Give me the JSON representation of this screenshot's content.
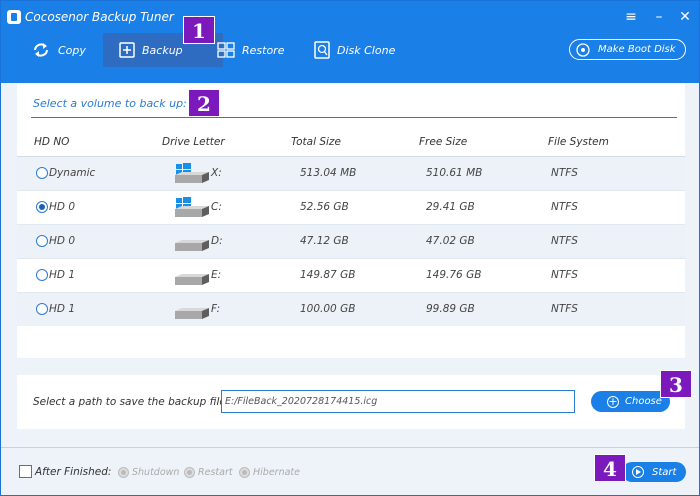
{
  "window": {
    "title": "Cocosenor Backup Tuner",
    "logo_icon": "app-logo-icon",
    "controls": [
      "menu-icon",
      "minimize-icon",
      "close-icon"
    ]
  },
  "nav": {
    "items": [
      {
        "label": "Copy",
        "icon": "copy-icon"
      },
      {
        "label": "Backup",
        "icon": "backup-icon",
        "active": true
      },
      {
        "label": "Restore",
        "icon": "restore-icon"
      },
      {
        "label": "Disk Clone",
        "icon": "disk-clone-icon"
      }
    ],
    "boot_disk_label": "Make Boot Disk"
  },
  "markers": [
    "1",
    "2",
    "3",
    "4"
  ],
  "volume": {
    "heading": "Select a volume to back up:",
    "columns": [
      "HD NO",
      "Drive Letter",
      "Total Size",
      "Free Size",
      "File System"
    ],
    "rows": [
      {
        "hd": "Dynamic",
        "letter": "X:",
        "total": "513.04 MB",
        "free": "510.61 MB",
        "fs": "NTFS",
        "selected": false,
        "icon": "windows-drive-icon"
      },
      {
        "hd": "HD 0",
        "letter": "C:",
        "total": "52.56 GB",
        "free": "29.41 GB",
        "fs": "NTFS",
        "selected": true,
        "icon": "windows-drive-icon"
      },
      {
        "hd": "HD 0",
        "letter": "D:",
        "total": "47.12 GB",
        "free": "47.02 GB",
        "fs": "NTFS",
        "selected": false,
        "icon": "drive-icon"
      },
      {
        "hd": "HD 1",
        "letter": "E:",
        "total": "149.87 GB",
        "free": "149.76 GB",
        "fs": "NTFS",
        "selected": false,
        "icon": "drive-icon"
      },
      {
        "hd": "HD 1",
        "letter": "F:",
        "total": "100.00 GB",
        "free": "99.89 GB",
        "fs": "NTFS",
        "selected": false,
        "icon": "drive-icon"
      }
    ]
  },
  "path": {
    "label": "Select a path to save the backup file:",
    "value": "E:/FileBack_2020728174415.icg",
    "choose_label": "Choose"
  },
  "footer": {
    "after_finished_label": "After Finished:",
    "options": [
      "Shutdown",
      "Restart",
      "Hibernate"
    ],
    "start_label": "Start"
  },
  "colors": {
    "accent": "#1a7fe6",
    "active_nav": "#2d6cc0",
    "marker": "#7b19bd",
    "heading": "#2a7ad8"
  }
}
